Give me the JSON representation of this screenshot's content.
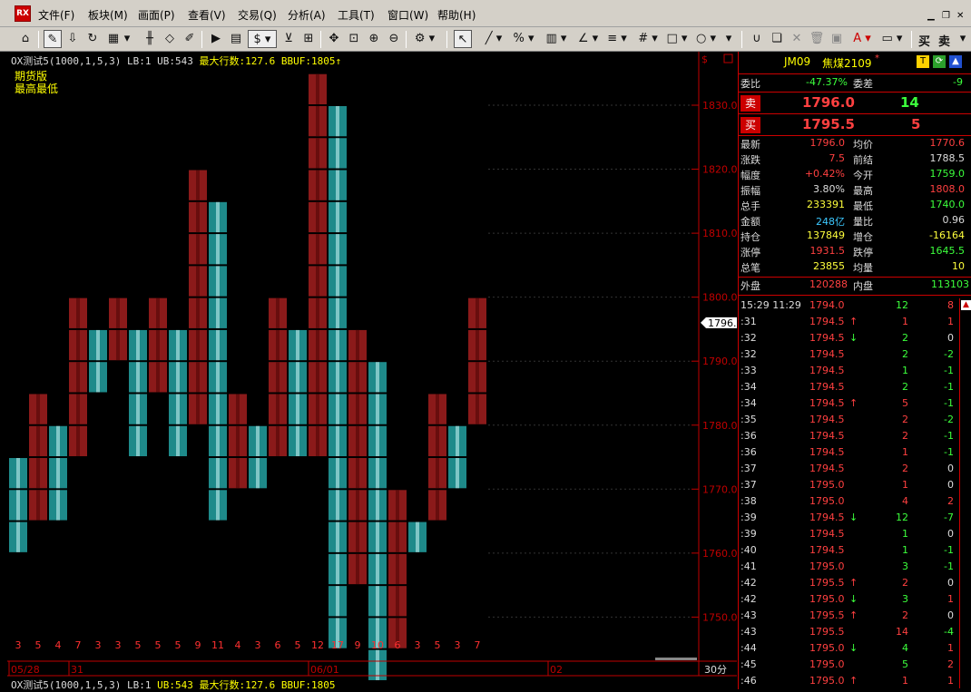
{
  "menu": {
    "logo": "RX",
    "items": [
      "文件(F)",
      "板块(M)",
      "画面(P)",
      "查看(V)",
      "交易(Q)",
      "分析(A)",
      "工具(T)",
      "窗口(W)",
      "帮助(H)"
    ]
  },
  "toolbar": {
    "dollar": "$",
    "buy_label": "买",
    "sell_label": "卖"
  },
  "chart": {
    "header_name": "OX测试5(1000,1,5,3)",
    "lb": "LB:1",
    "ub": "UB:543",
    "maxrows": "最大行数:127.6",
    "bbuf": "BBUF:1805",
    "sub1": "期货版",
    "sub2": "最高最低",
    "current_price": "1796.0",
    "period": "30分",
    "footer_name": "OX测试5(1000,1,5,3)",
    "footer_lb": "LB:1",
    "footer_ub": "UB:543",
    "footer_maxrows": "最大行数:127.6",
    "footer_bbuf": "BBUF:1805"
  },
  "chart_data": {
    "type": "point-and-figure",
    "box_size": 5,
    "y_ticks": [
      1750.0,
      1760.0,
      1770.0,
      1780.0,
      1790.0,
      1800.0,
      1810.0,
      1820.0,
      1830.0
    ],
    "x_dates": [
      "05/28",
      "31",
      "06/01",
      "02"
    ],
    "columns": [
      {
        "type": "O",
        "high": 1775,
        "low": 1760,
        "count": "3"
      },
      {
        "type": "X",
        "high": 1785,
        "low": 1765,
        "count": "5"
      },
      {
        "type": "O",
        "high": 1780,
        "low": 1765,
        "count": "4"
      },
      {
        "type": "X",
        "high": 1800,
        "low": 1775,
        "count": "7"
      },
      {
        "type": "O",
        "high": 1795,
        "low": 1785,
        "count": "3"
      },
      {
        "type": "X",
        "high": 1800,
        "low": 1790,
        "count": "3"
      },
      {
        "type": "O",
        "high": 1795,
        "low": 1775,
        "count": "5"
      },
      {
        "type": "X",
        "high": 1800,
        "low": 1785,
        "count": "5"
      },
      {
        "type": "O",
        "high": 1795,
        "low": 1775,
        "count": "5"
      },
      {
        "type": "X",
        "high": 1820,
        "low": 1780,
        "count": "9"
      },
      {
        "type": "O",
        "high": 1815,
        "low": 1765,
        "count": "11"
      },
      {
        "type": "X",
        "high": 1785,
        "low": 1770,
        "count": "4"
      },
      {
        "type": "O",
        "high": 1780,
        "low": 1770,
        "count": "3"
      },
      {
        "type": "X",
        "high": 1800,
        "low": 1775,
        "count": "6"
      },
      {
        "type": "O",
        "high": 1795,
        "low": 1775,
        "count": "5"
      },
      {
        "type": "X",
        "high": 1835,
        "low": 1775,
        "count": "12"
      },
      {
        "type": "O",
        "high": 1830,
        "low": 1745,
        "count": "17"
      },
      {
        "type": "X",
        "high": 1795,
        "low": 1755,
        "count": "9"
      },
      {
        "type": "O",
        "high": 1790,
        "low": 1740,
        "count": "10"
      },
      {
        "type": "X",
        "high": 1770,
        "low": 1745,
        "count": "6"
      },
      {
        "type": "O",
        "high": 1765,
        "low": 1760,
        "count": "3"
      },
      {
        "type": "X",
        "high": 1785,
        "low": 1765,
        "count": "5"
      },
      {
        "type": "O",
        "high": 1780,
        "low": 1770,
        "count": "3"
      },
      {
        "type": "X",
        "high": 1800,
        "low": 1780,
        "count": "7"
      }
    ]
  },
  "quote": {
    "code": "JM09",
    "name": "焦煤2109",
    "mark": "*",
    "btn_t": "T",
    "weibi_label": "委比",
    "weibi_value": "-47.37%",
    "weicha_label": "委差",
    "weicha_value": "-9",
    "sell_label": "卖",
    "sell_price": "1796.0",
    "sell_vol": "14",
    "buy_label": "买",
    "buy_price": "1795.5",
    "buy_vol": "5",
    "stats": [
      {
        "l1": "最新",
        "v1": "1796.0",
        "c1": "#ff4040",
        "l2": "均价",
        "v2": "1770.6",
        "c2": "#ff4040"
      },
      {
        "l1": "涨跌",
        "v1": "7.5",
        "c1": "#ff4040",
        "l2": "前结",
        "v2": "1788.5",
        "c2": "#dcdcdc"
      },
      {
        "l1": "幅度",
        "v1": "+0.42%",
        "c1": "#ff4040",
        "l2": "今开",
        "v2": "1759.0",
        "c2": "#3cff3c"
      },
      {
        "l1": "振幅",
        "v1": "3.80%",
        "c1": "#dcdcdc",
        "l2": "最高",
        "v2": "1808.0",
        "c2": "#ff4040"
      },
      {
        "l1": "总手",
        "v1": "233391",
        "c1": "#ffff3c",
        "l2": "最低",
        "v2": "1740.0",
        "c2": "#3cff3c"
      },
      {
        "l1": "金额",
        "v1": "248亿",
        "c1": "#3cc8ff",
        "l2": "量比",
        "v2": "0.96",
        "c2": "#dcdcdc"
      },
      {
        "l1": "持仓",
        "v1": "137849",
        "c1": "#ffff3c",
        "l2": "增仓",
        "v2": "-16164",
        "c2": "#ffff3c"
      },
      {
        "l1": "涨停",
        "v1": "1931.5",
        "c1": "#ff4040",
        "l2": "跌停",
        "v2": "1645.5",
        "c2": "#3cff3c"
      },
      {
        "l1": "总笔",
        "v1": "23855",
        "c1": "#ffff3c",
        "l2": "均量",
        "v2": "10",
        "c2": "#ffff3c"
      }
    ],
    "waipan_label": "外盘",
    "waipan_value": "120288",
    "neipan_label": "内盘",
    "neipan_value": "113103",
    "ticks": [
      {
        "t": "15:29 11:29",
        "p": "1794.0",
        "pc": "#ff4040",
        "a": "",
        "v": "12",
        "vc": "#3cff3c",
        "o": "8",
        "oc": "#ff4040"
      },
      {
        "t": ":31",
        "p": "1794.5",
        "pc": "#ff4040",
        "a": "↑",
        "ac": "#ff4040",
        "v": "1",
        "vc": "#ff4040",
        "o": "1",
        "oc": "#ff4040"
      },
      {
        "t": ":32",
        "p": "1794.5",
        "pc": "#ff4040",
        "a": "↓",
        "ac": "#3cff3c",
        "v": "2",
        "vc": "#3cff3c",
        "o": "0",
        "oc": "#dcdcdc"
      },
      {
        "t": ":32",
        "p": "1794.5",
        "pc": "#ff4040",
        "a": "",
        "v": "2",
        "vc": "#3cff3c",
        "o": "-2",
        "oc": "#3cff3c"
      },
      {
        "t": ":33",
        "p": "1794.5",
        "pc": "#ff4040",
        "a": "",
        "v": "1",
        "vc": "#3cff3c",
        "o": "-1",
        "oc": "#3cff3c"
      },
      {
        "t": ":34",
        "p": "1794.5",
        "pc": "#ff4040",
        "a": "",
        "v": "2",
        "vc": "#3cff3c",
        "o": "-1",
        "oc": "#3cff3c"
      },
      {
        "t": ":34",
        "p": "1794.5",
        "pc": "#ff4040",
        "a": "↑",
        "ac": "#ff4040",
        "v": "5",
        "vc": "#ff4040",
        "o": "-1",
        "oc": "#3cff3c"
      },
      {
        "t": ":35",
        "p": "1794.5",
        "pc": "#ff4040",
        "a": "",
        "v": "2",
        "vc": "#ff4040",
        "o": "-2",
        "oc": "#3cff3c"
      },
      {
        "t": ":36",
        "p": "1794.5",
        "pc": "#ff4040",
        "a": "",
        "v": "2",
        "vc": "#ff4040",
        "o": "-1",
        "oc": "#3cff3c"
      },
      {
        "t": ":36",
        "p": "1794.5",
        "pc": "#ff4040",
        "a": "",
        "v": "1",
        "vc": "#ff4040",
        "o": "-1",
        "oc": "#3cff3c"
      },
      {
        "t": ":37",
        "p": "1794.5",
        "pc": "#ff4040",
        "a": "",
        "v": "2",
        "vc": "#ff4040",
        "o": "0",
        "oc": "#dcdcdc"
      },
      {
        "t": ":37",
        "p": "1795.0",
        "pc": "#ff4040",
        "a": "",
        "v": "1",
        "vc": "#ff4040",
        "o": "0",
        "oc": "#dcdcdc"
      },
      {
        "t": ":38",
        "p": "1795.0",
        "pc": "#ff4040",
        "a": "",
        "v": "4",
        "vc": "#ff4040",
        "o": "2",
        "oc": "#ff4040"
      },
      {
        "t": ":39",
        "p": "1794.5",
        "pc": "#ff4040",
        "a": "↓",
        "ac": "#3cff3c",
        "v": "12",
        "vc": "#3cff3c",
        "o": "-7",
        "oc": "#3cff3c"
      },
      {
        "t": ":39",
        "p": "1794.5",
        "pc": "#ff4040",
        "a": "",
        "v": "1",
        "vc": "#3cff3c",
        "o": "0",
        "oc": "#dcdcdc"
      },
      {
        "t": ":40",
        "p": "1794.5",
        "pc": "#ff4040",
        "a": "",
        "v": "1",
        "vc": "#3cff3c",
        "o": "-1",
        "oc": "#3cff3c"
      },
      {
        "t": ":41",
        "p": "1795.0",
        "pc": "#ff4040",
        "a": "",
        "v": "3",
        "vc": "#3cff3c",
        "o": "-1",
        "oc": "#3cff3c"
      },
      {
        "t": ":42",
        "p": "1795.5",
        "pc": "#ff4040",
        "a": "↑",
        "ac": "#ff4040",
        "v": "2",
        "vc": "#ff4040",
        "o": "0",
        "oc": "#dcdcdc"
      },
      {
        "t": ":42",
        "p": "1795.0",
        "pc": "#ff4040",
        "a": "↓",
        "ac": "#3cff3c",
        "v": "3",
        "vc": "#3cff3c",
        "o": "1",
        "oc": "#ff4040"
      },
      {
        "t": ":43",
        "p": "1795.5",
        "pc": "#ff4040",
        "a": "↑",
        "ac": "#ff4040",
        "v": "2",
        "vc": "#ff4040",
        "o": "0",
        "oc": "#dcdcdc"
      },
      {
        "t": ":43",
        "p": "1795.5",
        "pc": "#ff4040",
        "a": "",
        "v": "14",
        "vc": "#ff4040",
        "o": "-4",
        "oc": "#3cff3c"
      },
      {
        "t": ":44",
        "p": "1795.0",
        "pc": "#ff4040",
        "a": "↓",
        "ac": "#3cff3c",
        "v": "4",
        "vc": "#3cff3c",
        "o": "1",
        "oc": "#ff4040"
      },
      {
        "t": ":45",
        "p": "1795.0",
        "pc": "#ff4040",
        "a": "",
        "v": "5",
        "vc": "#3cff3c",
        "o": "2",
        "oc": "#ff4040"
      },
      {
        "t": ":46",
        "p": "1795.0",
        "pc": "#ff4040",
        "a": "↑",
        "ac": "#ff4040",
        "v": "1",
        "vc": "#ff4040",
        "o": "1",
        "oc": "#ff4040"
      }
    ]
  },
  "colors": {
    "x_col": "#8b1a1a",
    "o_col": "#1e8a8a",
    "red": "#ff3030",
    "green": "#30ff30",
    "yellow": "#ffff00",
    "axis": "#c00000"
  }
}
